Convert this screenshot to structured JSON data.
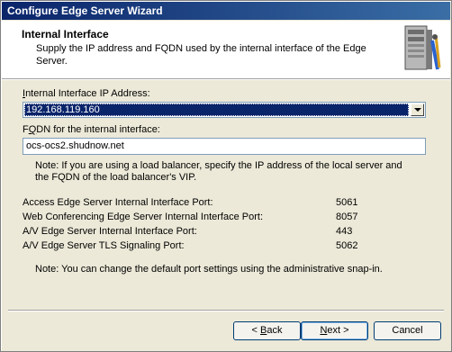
{
  "window": {
    "title": "Configure Edge Server Wizard"
  },
  "header": {
    "title": "Internal Interface",
    "subtitle": "Supply the IP address and FQDN used by the internal interface of the Edge Server.",
    "icon": "server-with-tools-icon"
  },
  "ip_field": {
    "label_pre": "",
    "label_accel": "I",
    "label_post": "nternal Interface IP Address:",
    "selected_value": "192.168.119.160"
  },
  "fqdn_field": {
    "label_pre": "F",
    "label_accel": "Q",
    "label_post": "DN for the internal interface:",
    "value": "ocs-ocs2.shudnow.net"
  },
  "note_load_balancer": "Note: If you are using a load balancer, specify the IP address of the local server and the FQDN of the load balancer's VIP.",
  "ports": [
    {
      "label": "Access Edge Server Internal Interface Port:",
      "value": "5061"
    },
    {
      "label": "Web Conferencing Edge Server Internal Interface Port:",
      "value": "8057"
    },
    {
      "label": "A/V Edge Server Internal Interface Port:",
      "value": "443"
    },
    {
      "label": "A/V Edge Server TLS Signaling Port:",
      "value": "5062"
    }
  ],
  "note_ports": "Note: You can change the default port settings using the administrative snap-in.",
  "buttons": {
    "back": {
      "prefix": "< ",
      "accel": "B",
      "rest": "ack"
    },
    "next": {
      "accel": "N",
      "rest": "ext >"
    },
    "cancel": "Cancel"
  }
}
